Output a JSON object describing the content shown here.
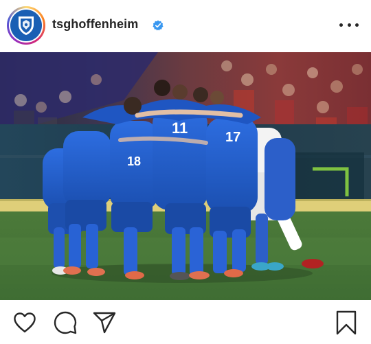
{
  "post": {
    "username": "tsghoffenheim",
    "verified": true,
    "avatar": {
      "icon": "club-crest-icon",
      "brand_color": "#1a5fb4"
    },
    "menu_icon": "more-icon",
    "image": {
      "icon": "team-huddle-photo"
    },
    "actions": {
      "like_icon": "heart-icon",
      "comment_icon": "comment-icon",
      "share_icon": "share-icon",
      "save_icon": "bookmark-icon"
    },
    "colors": {
      "verified_badge": "#3897f0",
      "text": "#262626",
      "kit_blue": "#1f5fd0"
    }
  }
}
